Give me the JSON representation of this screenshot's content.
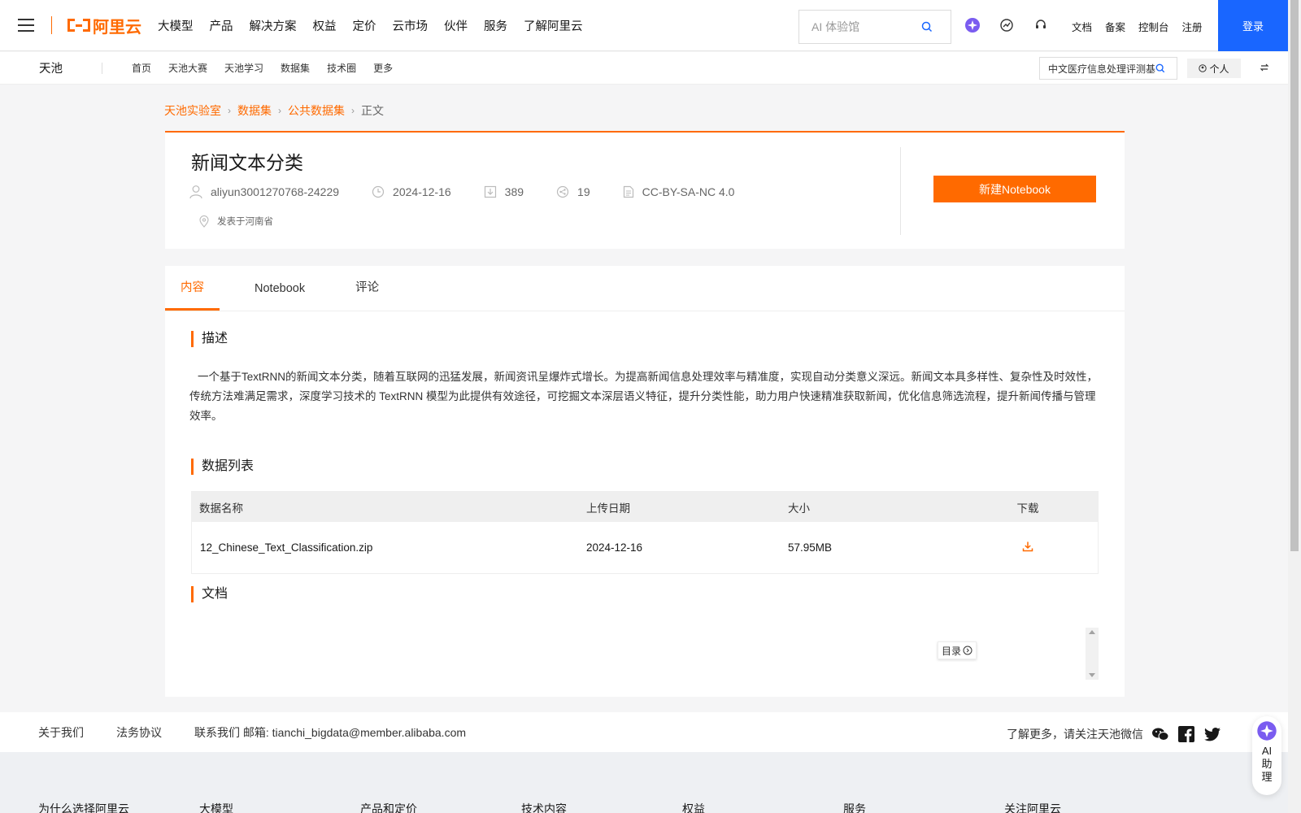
{
  "topnav": {
    "logo_text": "阿里云",
    "items": [
      "大模型",
      "产品",
      "解决方案",
      "权益",
      "定价",
      "云市场",
      "伙伴",
      "服务",
      "了解阿里云"
    ],
    "search_placeholder": "AI 体验馆",
    "links": [
      "文档",
      "备案",
      "控制台",
      "注册"
    ],
    "login_label": "登录",
    "brand_color": "#ff6a00",
    "login_color": "#1966ff"
  },
  "subnav": {
    "brand": "天池",
    "links": [
      "首页",
      "天池大赛",
      "天池学习",
      "数据集",
      "技术圈",
      "更多"
    ],
    "search_value": "中文医疗信息处理评测基",
    "personal_label": "个人"
  },
  "breadcrumb": {
    "items": [
      "天池实验室",
      "数据集",
      "公共数据集"
    ],
    "current": "正文"
  },
  "dataset": {
    "title": "新闻文本分类",
    "author": "aliyun3001270768-24229",
    "date": "2024-12-16",
    "downloads": "389",
    "shares": "19",
    "license": "CC-BY-SA-NC 4.0",
    "location": "发表于河南省",
    "new_notebook_label": "新建Notebook"
  },
  "tabs": [
    {
      "label": "内容",
      "active": true
    },
    {
      "label": "Notebook",
      "active": false
    },
    {
      "label": "评论",
      "active": false
    }
  ],
  "sections": {
    "description_title": "描述",
    "description": "一个基于TextRNN的新闻文本分类，随着互联网的迅猛发展，新闻资讯呈爆炸式增长。为提高新闻信息处理效率与精准度，实现自动分类意义深远。新闻文本具多样性、复杂性及时效性，传统方法难满足需求，深度学习技术的 TextRNN 模型为此提供有效途径，可挖掘文本深层语义特征，提升分类性能，助力用户快速精准获取新闻，优化信息筛选流程，提升新闻传播与管理效率。",
    "datalist_title": "数据列表",
    "docs_title": "文档",
    "toc_label": "目录"
  },
  "table": {
    "headers": [
      "数据名称",
      "上传日期",
      "大小",
      "下载"
    ],
    "rows": [
      {
        "name": "12_Chinese_Text_Classification.zip",
        "date": "2024-12-16",
        "size": "57.95MB"
      }
    ]
  },
  "footer": {
    "links": [
      "关于我们",
      "法务协议"
    ],
    "contact": "联系我们 邮箱: tianchi_bigdata@member.alibaba.com",
    "follow_text": "了解更多，请关注天池微信",
    "columns": [
      "为什么选择阿里云",
      "大模型",
      "产品和定价",
      "技术内容",
      "权益",
      "服务",
      "关注阿里云"
    ],
    "ai_assistant": [
      "AI",
      "助",
      "理"
    ]
  }
}
